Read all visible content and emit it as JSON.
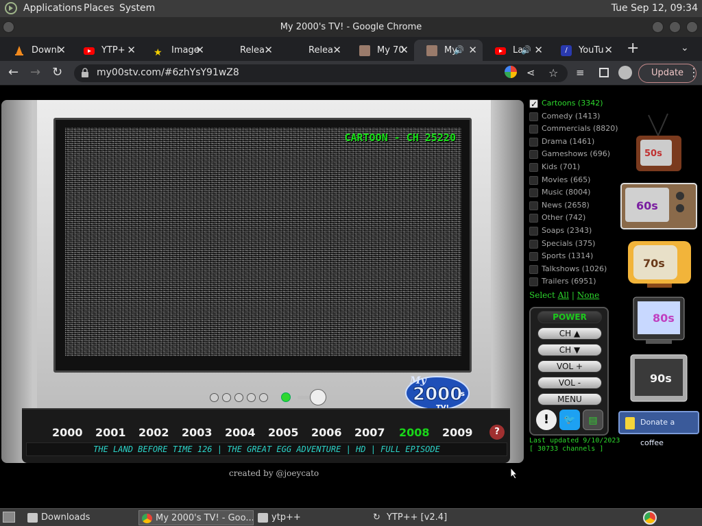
{
  "system_bar": {
    "menus": [
      "Applications",
      "Places",
      "System"
    ],
    "clock": "Tue Sep 12, 09:34"
  },
  "window": {
    "title": "My 2000's TV! - Google Chrome"
  },
  "tabs": [
    {
      "label": "Downl",
      "icon": "vlc-cone-icon"
    },
    {
      "label": "YTP+",
      "icon": "youtube-icon"
    },
    {
      "label": "Image",
      "icon": "star-icon"
    },
    {
      "label": "Relea",
      "icon": "none"
    },
    {
      "label": "Relea",
      "icon": "none"
    },
    {
      "label": "My 70",
      "icon": "face-icon"
    },
    {
      "label": "My",
      "icon": "face-icon",
      "active": true
    },
    {
      "label": "La",
      "icon": "youtube-icon"
    },
    {
      "label": "YouTu",
      "icon": "blue-icon"
    }
  ],
  "address_bar": {
    "url": "my00stv.com/#6zhYsY91wZ8",
    "update_label": "Update"
  },
  "tv": {
    "channel_label": "CARTOON - CH 25220",
    "logo_text": "My 2000's TV!",
    "years": [
      "2000",
      "2001",
      "2002",
      "2003",
      "2004",
      "2005",
      "2006",
      "2007",
      "2008",
      "2009"
    ],
    "selected_year": "2008",
    "help_glyph": "?",
    "ticker": "THE LAND BEFORE TIME 126 | THE GREAT EGG ADVENTURE | HD | FULL EPISODE",
    "credit": "created by @joeycato"
  },
  "categories": [
    {
      "label": "Cartoons (3342)",
      "selected": true
    },
    {
      "label": "Comedy (1413)",
      "selected": false
    },
    {
      "label": "Commercials (8820)",
      "selected": false
    },
    {
      "label": "Drama (1461)",
      "selected": false
    },
    {
      "label": "Gameshows (696)",
      "selected": false
    },
    {
      "label": "Kids (701)",
      "selected": false
    },
    {
      "label": "Movies (665)",
      "selected": false
    },
    {
      "label": "Music (8004)",
      "selected": false
    },
    {
      "label": "News (2658)",
      "selected": false
    },
    {
      "label": "Other (742)",
      "selected": false
    },
    {
      "label": "Soaps (2343)",
      "selected": false
    },
    {
      "label": "Specials (375)",
      "selected": false
    },
    {
      "label": "Sports (1314)",
      "selected": false
    },
    {
      "label": "Talkshows (1026)",
      "selected": false
    },
    {
      "label": "Trailers (6951)",
      "selected": false
    }
  ],
  "select": {
    "prefix": "Select",
    "all": "All",
    "divider": "|",
    "none": "None"
  },
  "remote": {
    "power": "POWER",
    "ch_up": "CH ▲",
    "ch_down": "CH ▼",
    "vol_up": "VOL +",
    "vol_down": "VOL -",
    "menu": "MENU",
    "icons": [
      "alert-icon",
      "twitter-icon",
      "stack-icon"
    ]
  },
  "updated": {
    "line1": "Last updated 9/10/2023",
    "line2": "[ 30733 channels ]"
  },
  "decade_tvs": [
    "50s",
    "60s",
    "70s",
    "80s",
    "90s"
  ],
  "donate": "Donate a coffee",
  "taskbar": [
    {
      "label": "Downloads",
      "icon": "folder-icon"
    },
    {
      "label": "My 2000's TV! - Goo...",
      "icon": "chrome-icon",
      "active": true
    },
    {
      "label": "ytp++",
      "icon": "folder-icon"
    },
    {
      "label": "YTP++ [v2.4]",
      "icon": "ytp-icon"
    }
  ],
  "colors": {
    "accent_green": "#2dd82d",
    "ticker_cyan": "#2bd3c8",
    "browser_bg": "#35363a",
    "donate_blue": "#3a5a9a"
  }
}
